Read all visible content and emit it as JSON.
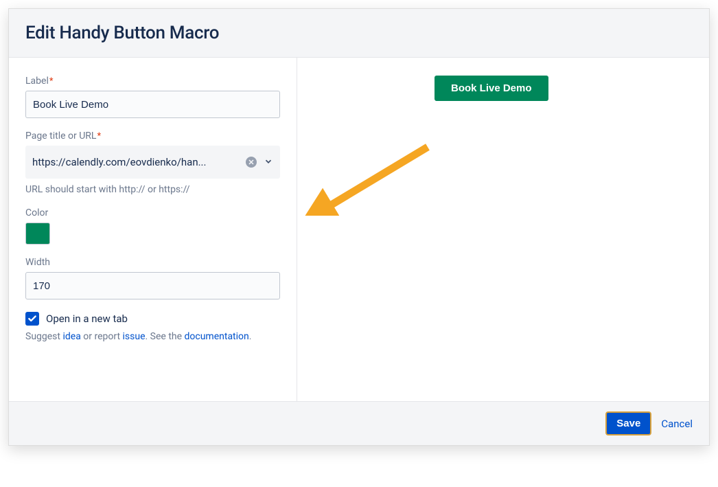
{
  "dialog": {
    "title": "Edit Handy Button Macro"
  },
  "form": {
    "label_field": {
      "label": "Label",
      "value": "Book Live Demo"
    },
    "url_field": {
      "label": "Page title or URL",
      "value": "https://calendly.com/eovdienko/han...",
      "help": "URL should start with http:// or https://"
    },
    "color_field": {
      "label": "Color",
      "value": "#00875a"
    },
    "width_field": {
      "label": "Width",
      "value": "170"
    },
    "new_tab": {
      "label": "Open in a new tab",
      "checked": true
    },
    "footer": {
      "prefix": "Suggest ",
      "idea_link": "idea",
      "mid1": " or report ",
      "issue_link": "issue",
      "mid2": ". See the ",
      "doc_link": "documentation",
      "suffix": "."
    }
  },
  "preview": {
    "button_label": "Book Live Demo"
  },
  "actions": {
    "save": "Save",
    "cancel": "Cancel"
  }
}
